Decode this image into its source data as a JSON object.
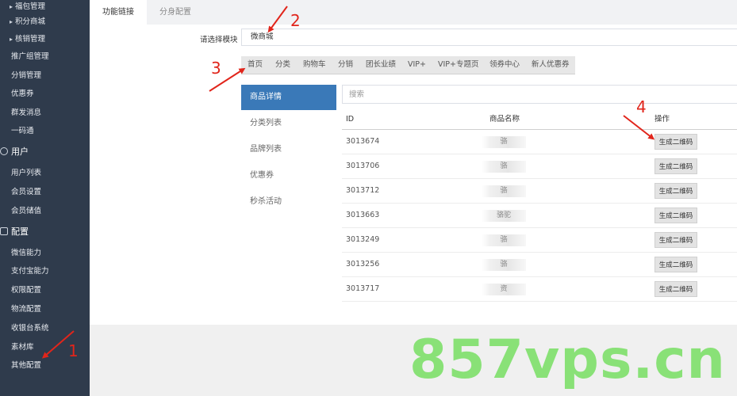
{
  "sidebar": {
    "items": [
      {
        "label": "福包管理"
      },
      {
        "label": "积分商城"
      },
      {
        "label": "核销管理"
      },
      {
        "label": "推广组管理"
      },
      {
        "label": "分销管理"
      },
      {
        "label": "优惠券"
      },
      {
        "label": "群发消息"
      },
      {
        "label": "一码通"
      },
      {
        "label": "用户"
      },
      {
        "label": "用户列表"
      },
      {
        "label": "会员设置"
      },
      {
        "label": "会员储值"
      },
      {
        "label": "配置"
      },
      {
        "label": "微信能力"
      },
      {
        "label": "支付宝能力"
      },
      {
        "label": "权限配置"
      },
      {
        "label": "物流配置"
      },
      {
        "label": "收银台系统"
      },
      {
        "label": "素材库"
      },
      {
        "label": "其他配置"
      }
    ]
  },
  "tabs": [
    {
      "label": "功能链接"
    },
    {
      "label": "分身配置"
    }
  ],
  "module_select": {
    "label": "请选择模块",
    "value": "微商城"
  },
  "page_nav": [
    {
      "label": "首页"
    },
    {
      "label": "分类"
    },
    {
      "label": "购物车"
    },
    {
      "label": "分销"
    },
    {
      "label": "团长业绩"
    },
    {
      "label": "VIP+"
    },
    {
      "label": "VIP+专题页"
    },
    {
      "label": "领券中心"
    },
    {
      "label": "新人优惠券"
    }
  ],
  "left_menu": [
    {
      "label": "商品详情"
    },
    {
      "label": "分类列表"
    },
    {
      "label": "品牌列表"
    },
    {
      "label": "优惠券"
    },
    {
      "label": "秒杀活动"
    }
  ],
  "search": {
    "placeholder": "搜索"
  },
  "table": {
    "headers": {
      "id": "ID",
      "name": "商品名称",
      "action": "操作"
    },
    "rows": [
      {
        "id": "3013674",
        "name": "骆",
        "action": "生成二维码"
      },
      {
        "id": "3013706",
        "name": "骆",
        "action": "生成二维码"
      },
      {
        "id": "3013712",
        "name": "骆",
        "action": "生成二维码"
      },
      {
        "id": "3013663",
        "name": "骆驼",
        "action": "生成二维码"
      },
      {
        "id": "3013249",
        "name": "骆",
        "action": "生成二维码"
      },
      {
        "id": "3013256",
        "name": "骆",
        "action": "生成二维码"
      },
      {
        "id": "3013717",
        "name": "资",
        "action": "生成二维码"
      }
    ]
  },
  "annotations": {
    "n1": "1",
    "n2": "2",
    "n3": "3",
    "n4": "4"
  },
  "watermark": "857vps.cn",
  "colors": {
    "sidebar_bg": "#2f3b4c",
    "active_menu": "#3a79b8",
    "annotation": "#e1251b",
    "watermark": "#7ee06b"
  }
}
